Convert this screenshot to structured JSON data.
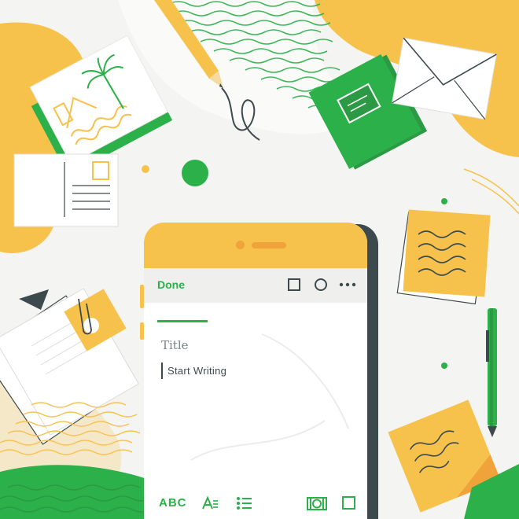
{
  "app": {
    "toolbar": {
      "done_label": "Done",
      "icons": [
        "checkbox-icon",
        "circle-icon",
        "more-options-icon"
      ]
    },
    "editor": {
      "title_placeholder": "Title",
      "body_placeholder": "Start Writing"
    },
    "bottom_toolbar": {
      "text_format_label": "ABC",
      "icons": [
        "font-size-icon",
        "bulleted-list-icon",
        "camera-icon",
        "sketch-square-icon"
      ]
    }
  },
  "colors": {
    "accent_green": "#2cb04a",
    "accent_yellow": "#f7c24c",
    "ink": "#3d4a4d",
    "background": "#f4f4f2"
  }
}
